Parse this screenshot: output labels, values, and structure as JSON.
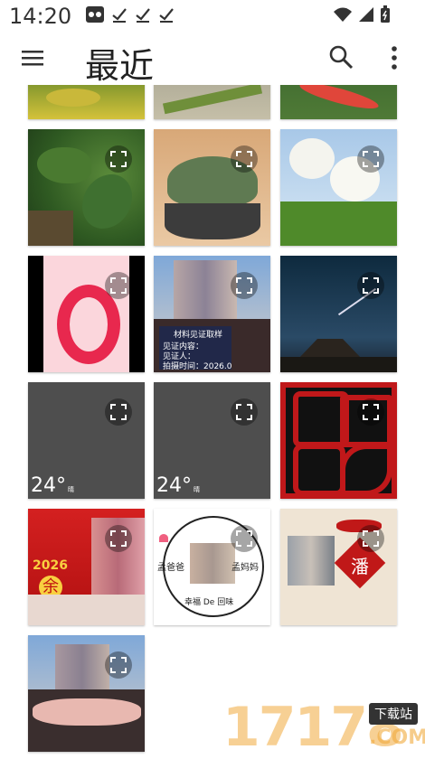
{
  "status_bar": {
    "time": "14:20"
  },
  "app_bar": {
    "title": "最近"
  },
  "tiles": {
    "t10": {
      "temp": "24°",
      "temp_sub": "晴"
    },
    "t11": {
      "temp": "24°",
      "temp_sub": "晴"
    },
    "t7": {
      "caption_title": "材料见证取样",
      "caption_line1": "见证内容：",
      "caption_line2": "见证人：",
      "caption_line3": "拍摄时间：2026.0"
    },
    "t13": {
      "year": "2026",
      "char": "余"
    },
    "t14": {
      "text_left": "孟爸爸",
      "text_right": "孟妈妈",
      "text_bottom": "幸福 De 回味"
    },
    "t15": {
      "char": "潘"
    }
  },
  "watermark": {
    "number": "17178",
    "badge": "下载站",
    "domain": ".COM"
  },
  "colors": {
    "background": "#ffffff",
    "text": "#222222",
    "tile_gray": "#4e4e4e"
  }
}
